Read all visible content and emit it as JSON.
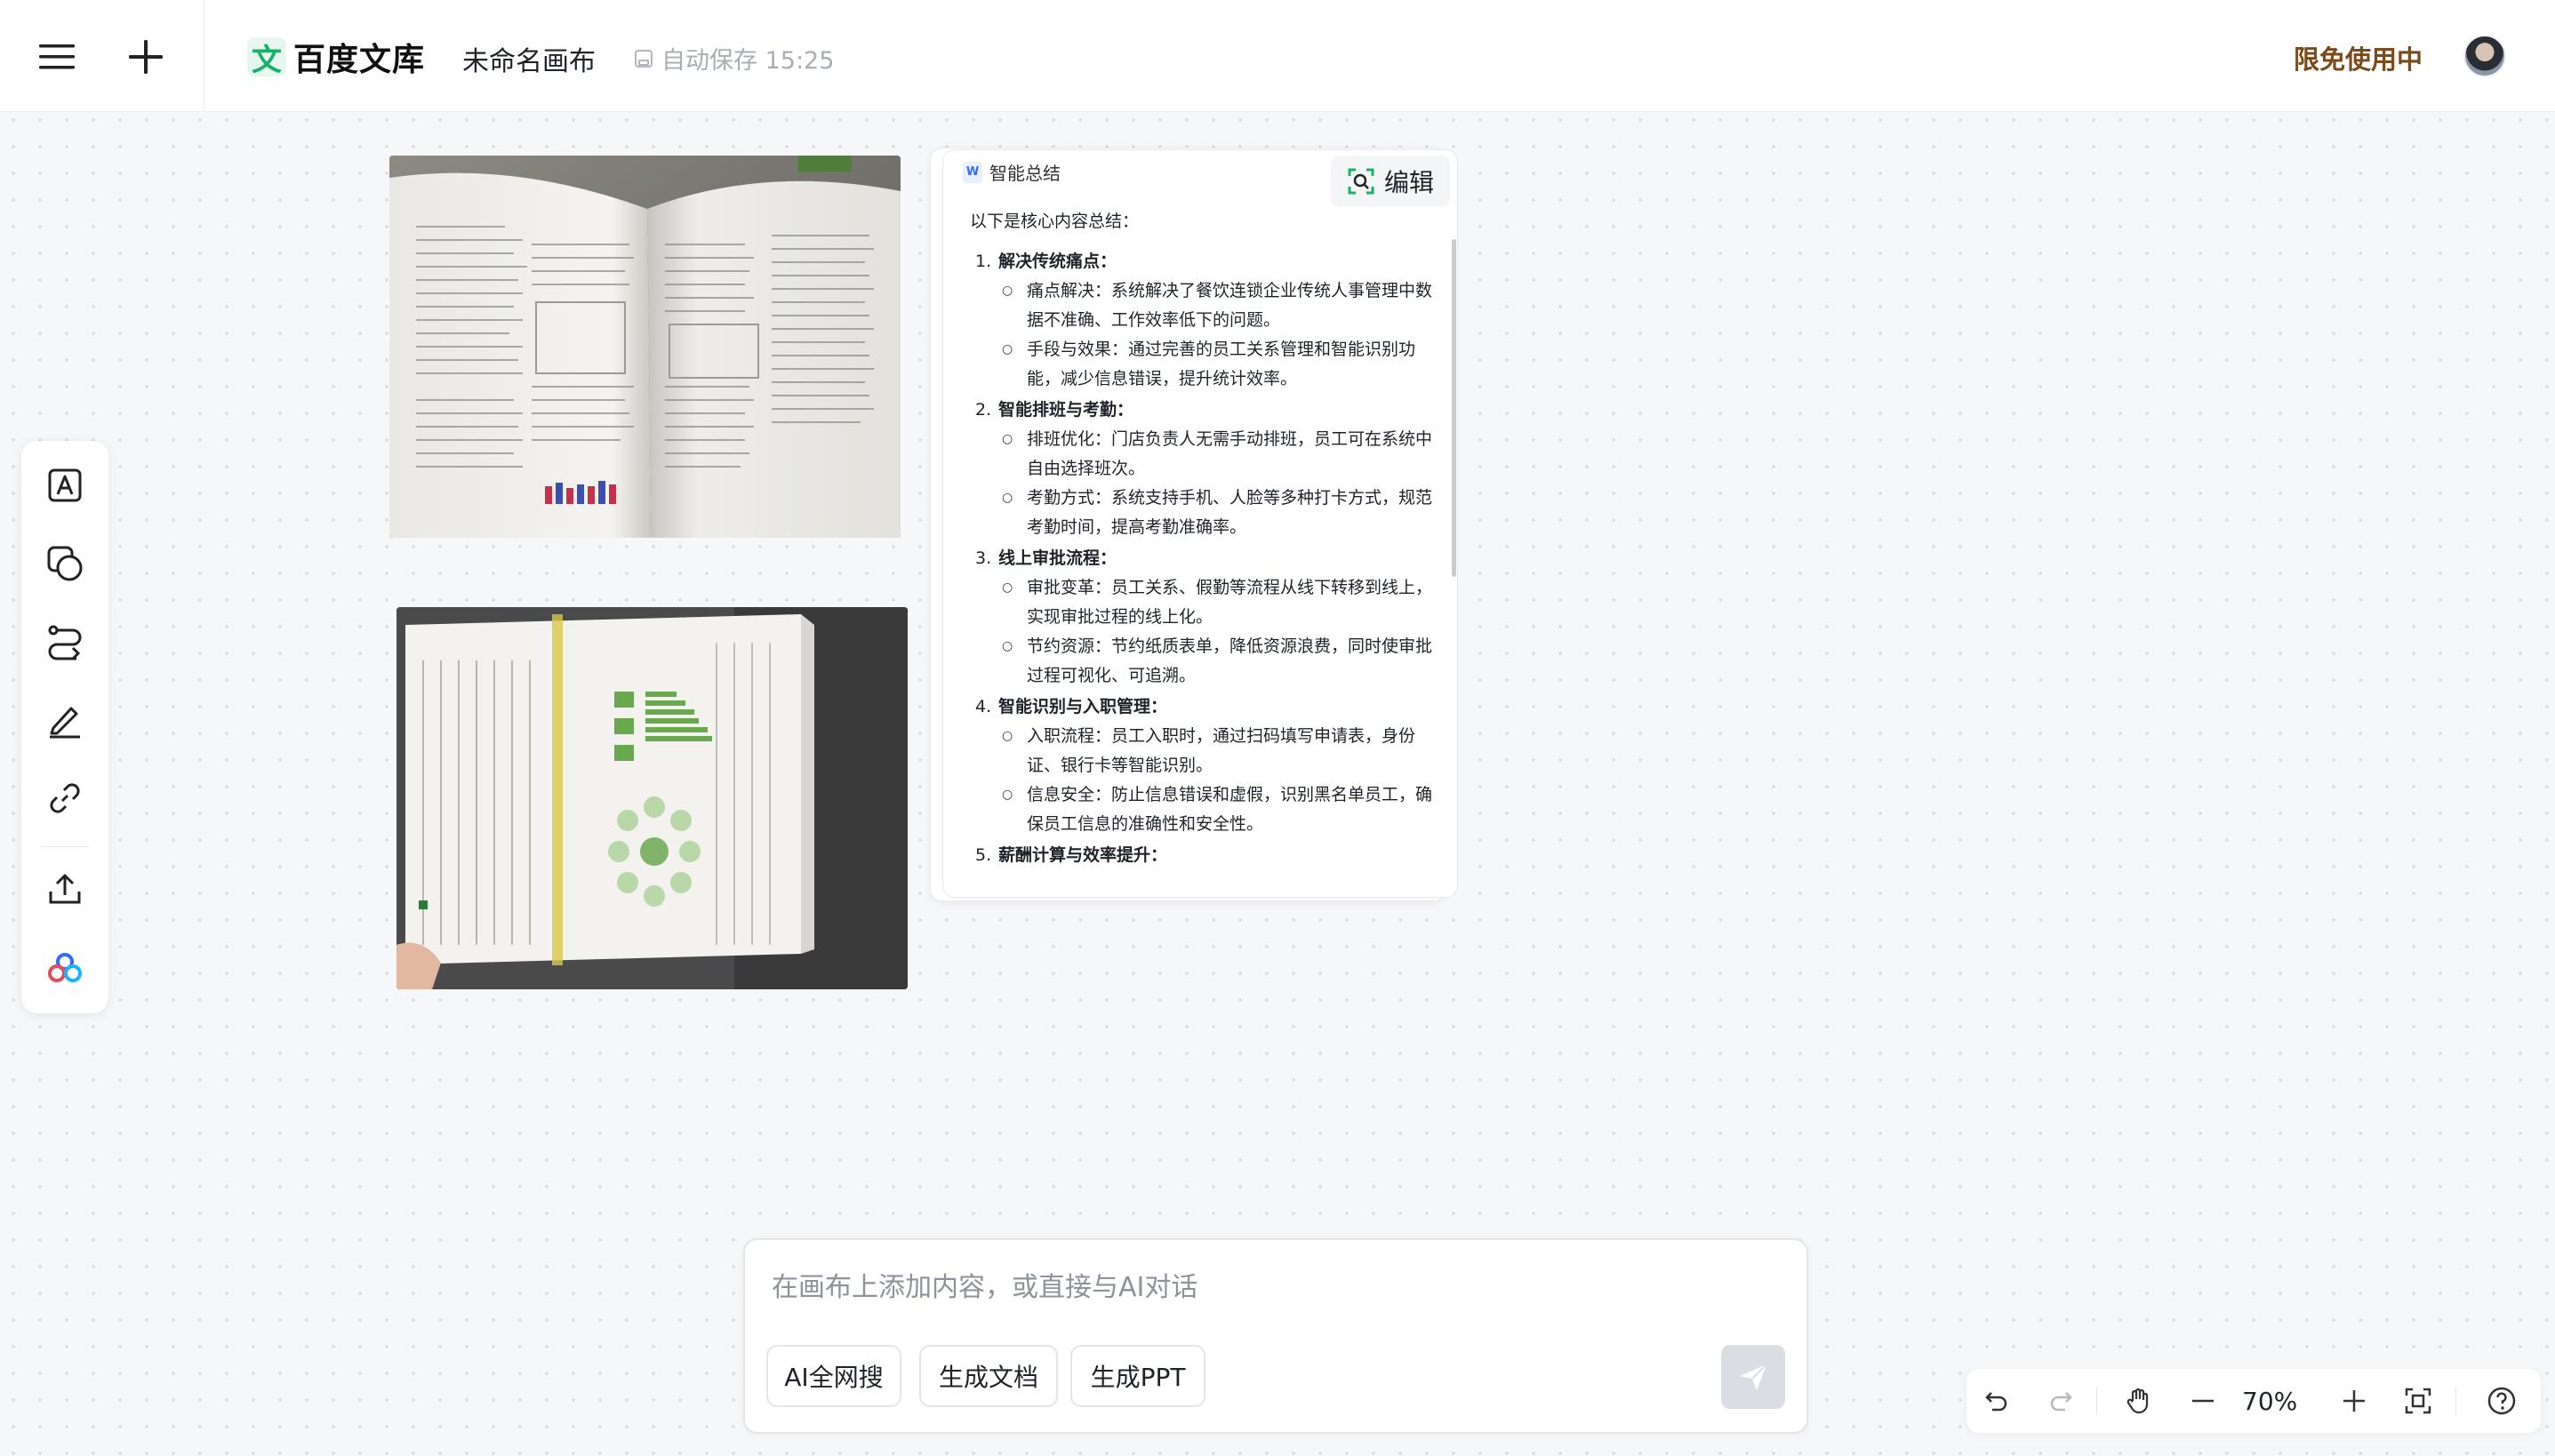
{
  "header": {
    "menu_icon": "menu-icon",
    "new_icon": "plus-icon",
    "logo_mark": "文",
    "logo_text": "百度文库",
    "doc_title": "未命名画布",
    "autosave": "自动保存 15:25",
    "free_use": "限免使用中"
  },
  "toolbar": {
    "tools": [
      "text-icon",
      "shape-icon",
      "connector-icon",
      "pen-icon",
      "link-icon",
      "upload-icon",
      "baidu-netdisk-icon"
    ]
  },
  "summary_card": {
    "title": "智能总结",
    "edit_label": "编辑",
    "intro": "以下是核心内容总结：",
    "sections": [
      {
        "num": "1.",
        "title": "解决传统痛点",
        "bullets": [
          "痛点解决：系统解决了餐饮连锁企业传统人事管理中数据不准确、工作效率低下的问题。",
          "手段与效果：通过完善的员工关系管理和智能识别功能，减少信息错误，提升统计效率。"
        ]
      },
      {
        "num": "2.",
        "title": "智能排班与考勤",
        "bullets": [
          "排班优化：门店负责人无需手动排班，员工可在系统中自由选择班次。",
          "考勤方式：系统支持手机、人脸等多种打卡方式，规范考勤时间，提高考勤准确率。"
        ]
      },
      {
        "num": "3.",
        "title": "线上审批流程",
        "bullets": [
          "审批变革：员工关系、假勤等流程从线下转移到线上，实现审批过程的线上化。",
          "节约资源：节约纸质表单，降低资源浪费，同时使审批过程可视化、可追溯。"
        ]
      },
      {
        "num": "4.",
        "title": "智能识别与入职管理",
        "bullets": [
          "入职流程：员工入职时，通过扫码填写申请表，身份证、银行卡等智能识别。",
          "信息安全：防止信息错误和虚假，识别黑名单员工，确保员工信息的准确性和安全性。"
        ]
      },
      {
        "num": "5.",
        "title": "薪酬计算与效率提升",
        "bullets": []
      }
    ]
  },
  "chat": {
    "placeholder": "在画布上添加内容，或直接与AI对话",
    "value": "",
    "chips": [
      "AI全网搜",
      "生成文档",
      "生成PPT"
    ]
  },
  "controls": {
    "zoom": "70%"
  },
  "colors": {
    "brand_green": "#17b26a",
    "free_use_brown": "#7a4a1b",
    "canvas_bg": "#f6f7f9"
  }
}
